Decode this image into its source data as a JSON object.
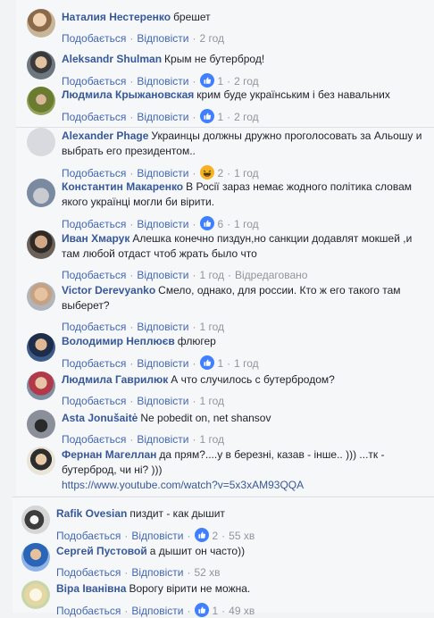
{
  "labels": {
    "like": "Подобається",
    "reply": "Відповісти"
  },
  "colors": {
    "link": "#365899",
    "action": "#4267b2",
    "meta": "#90949c",
    "like": "#4080ff",
    "haha": "#f7b125"
  },
  "comments": [
    {
      "name": "Наталия Нестеренко",
      "text": "брешет",
      "reactions": [],
      "count": "",
      "time": "2 год",
      "edited": ""
    },
    {
      "name": "Aleksandr Shulman",
      "text": "Крым не бутерброд!",
      "reactions": [
        "like-icon"
      ],
      "count": "1",
      "time": "2 год",
      "edited": ""
    },
    {
      "name": "Людмила Крыжановская",
      "text": "крим буде українським і без навальних",
      "reactions": [
        "like-icon"
      ],
      "count": "1",
      "time": "2 год",
      "edited": ""
    },
    {
      "name": "Alexander Phage",
      "text": "Украинцы должны дружно проголосовать за Альошу и выбрать его президентом..",
      "reactions": [
        "haha-icon"
      ],
      "count": "2",
      "time": "1 год",
      "edited": ""
    },
    {
      "name": "Константин Макаренко",
      "text": "В Росії зараз немає жодного політика словам якого українці могли би вірити.",
      "reactions": [
        "like-icon"
      ],
      "count": "6",
      "time": "1 год",
      "edited": ""
    },
    {
      "name": "Иван Хмарук",
      "text": "Алешка конечно пиздун,но санкции додавлят мокшей ,и там любой отдаст чтоб жрать было что",
      "reactions": [],
      "count": "",
      "time": "1 год",
      "edited": "Відредаговано"
    },
    {
      "name": "Victor Derevyanko",
      "text": "Смело, однако, для россии. Кто ж его такого там выберет?",
      "reactions": [],
      "count": "",
      "time": "1 год",
      "edited": ""
    },
    {
      "name": "Володимир Неплюєв",
      "text": "флюгер",
      "reactions": [
        "like-icon"
      ],
      "count": "1",
      "time": "1 год",
      "edited": ""
    },
    {
      "name": "Людмила Гаврилюк",
      "text": "А что случилось с бутербродом?",
      "reactions": [],
      "count": "",
      "time": "1 год",
      "edited": ""
    },
    {
      "name": "Asta Jonušaitė",
      "text": "Ne pobedit on, net shansov",
      "reactions": [],
      "count": "",
      "time": "1 год",
      "edited": ""
    },
    {
      "name": "Фернан Магеллан",
      "text": "да прям?....у в березні, казав - інше.. ))) ...тк - бутерброд, чи ні? )))",
      "link": "https://www.youtube.com/watch?v=5x3xAM93QQA",
      "reactions": [],
      "count": "",
      "time": "",
      "edited": ""
    },
    {
      "name": "Rafik Ovesian",
      "text": "пиздит - как дышит",
      "reactions": [
        "like-icon"
      ],
      "count": "2",
      "time": "55 хв",
      "edited": ""
    },
    {
      "name": "Сергей Пустовой",
      "text": "а дышит он часто))",
      "reactions": [],
      "count": "",
      "time": "52 хв",
      "edited": ""
    },
    {
      "name": "Віра Іванівна",
      "text": "Ворогу вірити не можна.",
      "reactions": [
        "like-icon"
      ],
      "count": "1",
      "time": "49 хв",
      "edited": ""
    }
  ]
}
